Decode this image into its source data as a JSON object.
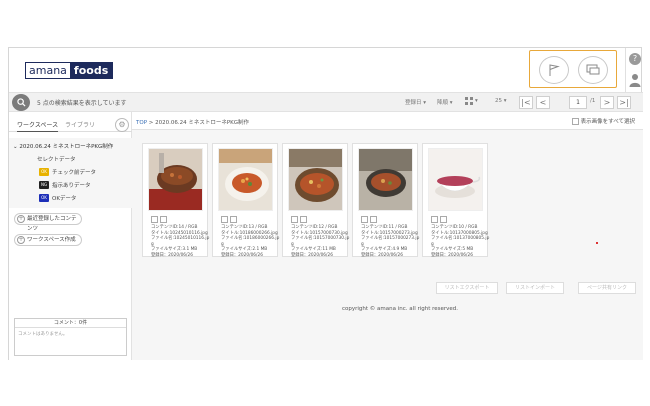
{
  "header": {
    "logo_left": "amana",
    "logo_right": "foods"
  },
  "rightbar": {
    "help": "?"
  },
  "toolbar": {
    "results_text": "5 点の検索結果を表示しています",
    "sort_label": "登録日 ▾",
    "order_label": "降順 ▾",
    "per_page": "25 ▾",
    "first": "|<",
    "prev": "<",
    "page": "1",
    "page_total": "/1",
    "next": ">",
    "last": ">|"
  },
  "sidebar": {
    "tabs": [
      "ワークスペース",
      "ライブラリ"
    ],
    "gear": "⚙",
    "tree_root": "2020.06.24 ミネストローネPKG制作",
    "tree_items": [
      {
        "tag": "",
        "label": "セレクトデータ"
      },
      {
        "tag": "OK",
        "label": "チェック前データ",
        "color": "#e8b200"
      },
      {
        "tag": "NG",
        "label": "指示ありデータ",
        "color": "#222222"
      },
      {
        "tag": "OK",
        "label": "OKデータ",
        "color": "#1d2fb8"
      }
    ],
    "recent_button": "最近登録したコンテンツ",
    "workspace_button": "ワークスペース作成",
    "comment_header": "コメント：0件",
    "comment_body": "コメントはありません。"
  },
  "content": {
    "crumb_link": "TOP",
    "crumb_sep": " > ",
    "crumb_current": "2020.06.24 ミネストローネPKG制作",
    "select_all": "表示画像をすべて選択",
    "cards": [
      {
        "l1": "コンテンツID:14 / RGB",
        "l2": "タイトル:10245010116.jpg",
        "l3": "ファイル名:10245010116.jp",
        "l4": "g",
        "l5": "ファイルサイズ:3.1 MB",
        "l6": "登録日：2020/06/26"
      },
      {
        "l1": "コンテンツID:13 / RGB",
        "l2": "タイトル:10186000266.jpg",
        "l3": "ファイル名:10186000266.jp",
        "l4": "g",
        "l5": "ファイルサイズ:2.1 MB",
        "l6": "登録日：2020/06/26"
      },
      {
        "l1": "コンテンツID:12 / RGB",
        "l2": "タイトル:10157000730.jpg",
        "l3": "ファイル名:10157000730.jp",
        "l4": "g",
        "l5": "ファイルサイズ:11 MB",
        "l6": "登録日：2020/06/26"
      },
      {
        "l1": "コンテンツID:11 / RGB",
        "l2": "タイトル:10157000273.jpg",
        "l3": "ファイル名:10157000273.jp",
        "l4": "g",
        "l5": "ファイルサイズ:4.9 MB",
        "l6": "登録日：2020/06/26"
      },
      {
        "l1": "コンテンツID:10 / RGB",
        "l2": "タイトル:10137000805.jpg",
        "l3": "ファイル名:10137000805.jp",
        "l4": "g",
        "l5": "ファイルサイズ:5 MB",
        "l6": "登録日：2020/06/26"
      }
    ],
    "export_button": "リストエクスポート",
    "import_button": "リストインポート",
    "share_button": "ページ共有リンク",
    "copyright": "copyright © amana inc. all right reserved."
  },
  "colors": {
    "highlight": "#e8a83a",
    "logo_navy": "#1d2a5c"
  }
}
